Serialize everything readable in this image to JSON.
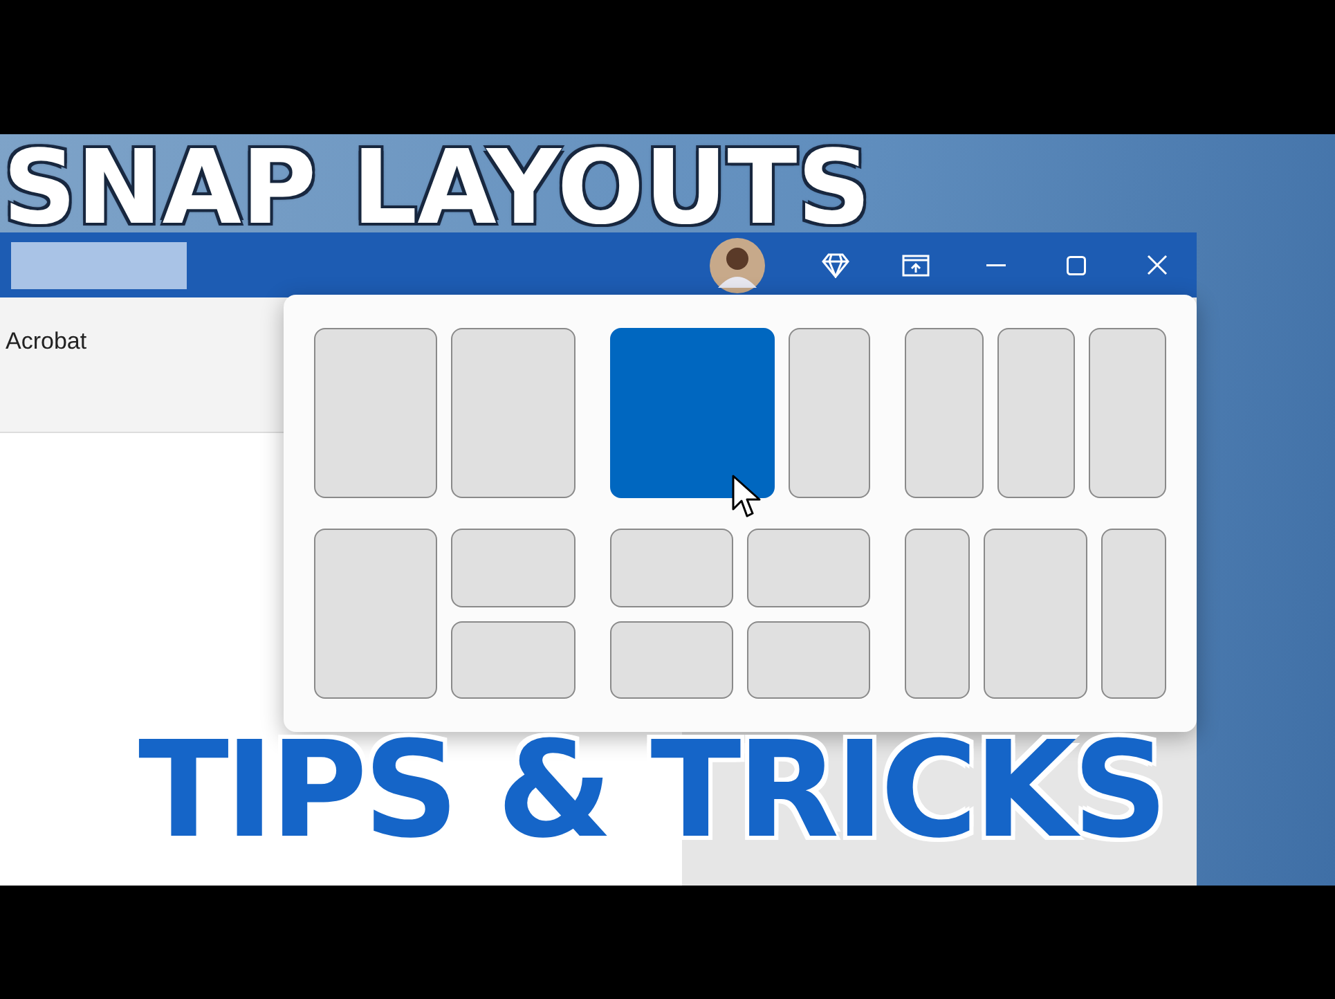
{
  "headline_top": "SNAP LAYOUTS",
  "window": {
    "ribbon_tab": "Acrobat"
  },
  "snap_layouts": [
    {
      "kind": "halves",
      "zones": [
        {
          "selected": false
        },
        {
          "selected": false
        }
      ]
    },
    {
      "kind": "two-thirds",
      "zones": [
        {
          "selected": true
        },
        {
          "selected": false
        }
      ]
    },
    {
      "kind": "thirds",
      "zones": [
        {
          "selected": false
        },
        {
          "selected": false
        },
        {
          "selected": false
        }
      ]
    },
    {
      "kind": "main-stack",
      "zones": [
        {
          "selected": false
        },
        {
          "selected": false
        },
        {
          "selected": false
        }
      ]
    },
    {
      "kind": "quad",
      "zones": [
        {
          "selected": false
        },
        {
          "selected": false
        },
        {
          "selected": false
        },
        {
          "selected": false
        }
      ]
    },
    {
      "kind": "wide-center",
      "zones": [
        {
          "selected": false
        },
        {
          "selected": false
        },
        {
          "selected": false
        }
      ]
    }
  ],
  "headline_bottom": "TIPS & TRICKS"
}
